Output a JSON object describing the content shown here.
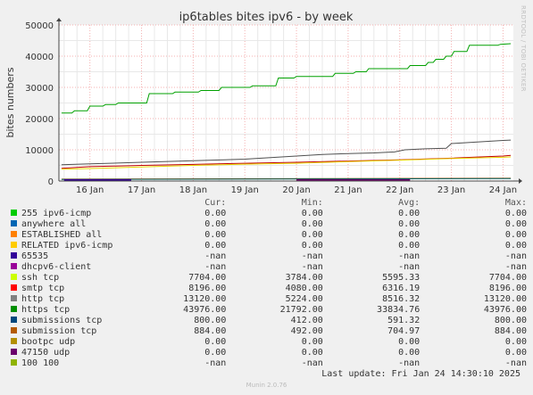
{
  "chart_data": {
    "type": "line",
    "title": "ip6tables bites ipv6 - by week",
    "ylabel": "bites numbers",
    "xlabel": "",
    "ylim": [
      0,
      50000
    ],
    "yticks": [
      0,
      10000,
      20000,
      30000,
      40000,
      50000
    ],
    "ytick_labels": [
      "0",
      "10000",
      "20000",
      "30000",
      "40000",
      "50000"
    ],
    "xlim": [
      15.4,
      24.2
    ],
    "xticks": [
      16,
      17,
      18,
      19,
      20,
      21,
      22,
      23,
      24
    ],
    "xtick_labels": [
      "16 Jan",
      "17 Jan",
      "18 Jan",
      "19 Jan",
      "20 Jan",
      "21 Jan",
      "22 Jan",
      "23 Jan",
      "24 Jan"
    ],
    "grid": true,
    "x_unit": "days of January 2025",
    "series": [
      {
        "name": "https tcp",
        "color": "#00a000",
        "x": [
          15.45,
          15.65,
          15.7,
          15.95,
          16.0,
          16.25,
          16.3,
          16.5,
          16.55,
          17.1,
          17.15,
          17.6,
          17.65,
          18.1,
          18.15,
          18.5,
          18.55,
          19.1,
          19.15,
          19.2,
          19.25,
          19.6,
          19.65,
          19.95,
          20.0,
          20.7,
          20.75,
          21.1,
          21.15,
          21.35,
          21.4,
          22.15,
          22.2,
          22.5,
          22.55,
          22.65,
          22.7,
          22.85,
          22.9,
          23.0,
          23.05,
          23.3,
          23.35,
          23.9,
          23.95,
          24.15
        ],
        "y": [
          21800,
          21800,
          22500,
          22500,
          24000,
          24000,
          24500,
          24500,
          25000,
          25000,
          28000,
          28000,
          28500,
          28500,
          29000,
          29000,
          30000,
          30000,
          30500,
          30500,
          30500,
          30500,
          33000,
          33000,
          33500,
          33500,
          34500,
          34500,
          35000,
          35000,
          36000,
          36000,
          37000,
          37000,
          38000,
          38000,
          39000,
          39000,
          40000,
          40000,
          41500,
          41500,
          43500,
          43500,
          43800,
          44000
        ]
      },
      {
        "name": "http tcp",
        "color": "#505050",
        "x": [
          15.45,
          16.0,
          17.0,
          18.0,
          19.0,
          19.5,
          20.0,
          20.5,
          21.0,
          21.5,
          21.9,
          22.1,
          22.5,
          22.9,
          23.0,
          23.5,
          24.0,
          24.15
        ],
        "y": [
          5200,
          5500,
          6000,
          6500,
          7000,
          7500,
          8000,
          8500,
          8800,
          9000,
          9300,
          10000,
          10300,
          10500,
          12000,
          12500,
          13000,
          13120
        ]
      },
      {
        "name": "smtp tcp",
        "color": "#c00000",
        "x": [
          15.45,
          16.0,
          16.5,
          17.0,
          18.0,
          19.0,
          20.0,
          21.0,
          22.0,
          23.0,
          23.5,
          24.0,
          24.15
        ],
        "y": [
          4080,
          4600,
          4800,
          5000,
          5300,
          5700,
          6000,
          6400,
          6800,
          7300,
          7700,
          8000,
          8196
        ]
      },
      {
        "name": "ssh tcp",
        "color": "#e8d800",
        "x": [
          15.45,
          16.0,
          17.0,
          18.0,
          19.0,
          20.0,
          21.0,
          22.0,
          23.0,
          24.0,
          24.15
        ],
        "y": [
          3784,
          4000,
          4500,
          5000,
          5400,
          5700,
          6200,
          6700,
          7200,
          7600,
          7704
        ]
      },
      {
        "name": "ESTABLISHED all",
        "color": "#ea8f00",
        "x": [
          15.45,
          24.15
        ],
        "y": [
          0,
          0
        ]
      },
      {
        "name": "submission tcp",
        "color": "#b05000",
        "x": [
          15.45,
          24.15
        ],
        "y": [
          600,
          884
        ]
      },
      {
        "name": "submissions tcp",
        "color": "#006060",
        "x": [
          15.45,
          24.15
        ],
        "y": [
          500,
          800
        ]
      }
    ],
    "legend": {
      "headers": [
        "Cur:",
        "Min:",
        "Avg:",
        "Max:"
      ],
      "rows": [
        {
          "name": "255 ipv6-icmp",
          "color": "#00cc00",
          "cur": "0.00",
          "min": "0.00",
          "avg": "0.00",
          "max": "0.00"
        },
        {
          "name": "anywhere all",
          "color": "#0066b3",
          "cur": "0.00",
          "min": "0.00",
          "avg": "0.00",
          "max": "0.00"
        },
        {
          "name": "ESTABLISHED all",
          "color": "#ff8000",
          "cur": "0.00",
          "min": "0.00",
          "avg": "0.00",
          "max": "0.00"
        },
        {
          "name": "RELATED ipv6-icmp",
          "color": "#ffcc00",
          "cur": "0.00",
          "min": "0.00",
          "avg": "0.00",
          "max": "0.00"
        },
        {
          "name": "65535",
          "color": "#330099",
          "cur": "-nan",
          "min": "-nan",
          "avg": "-nan",
          "max": "-nan"
        },
        {
          "name": "dhcpv6-client",
          "color": "#990099",
          "cur": "-nan",
          "min": "-nan",
          "avg": "-nan",
          "max": "-nan"
        },
        {
          "name": "ssh tcp",
          "color": "#ccff00",
          "cur": "7704.00",
          "min": "3784.00",
          "avg": "5595.33",
          "max": "7704.00"
        },
        {
          "name": "smtp tcp",
          "color": "#ff0000",
          "cur": "8196.00",
          "min": "4080.00",
          "avg": "6316.19",
          "max": "8196.00"
        },
        {
          "name": "http tcp",
          "color": "#808080",
          "cur": "13120.00",
          "min": "5224.00",
          "avg": "8516.32",
          "max": "13120.00"
        },
        {
          "name": "https tcp",
          "color": "#008f00",
          "cur": "43976.00",
          "min": "21792.00",
          "avg": "33834.76",
          "max": "43976.00"
        },
        {
          "name": "submissions tcp",
          "color": "#00487d",
          "cur": "800.00",
          "min": "412.00",
          "avg": "591.32",
          "max": "800.00"
        },
        {
          "name": "submission tcp",
          "color": "#b35a00",
          "cur": "884.00",
          "min": "492.00",
          "avg": "704.97",
          "max": "884.00"
        },
        {
          "name": "bootpc udp",
          "color": "#b38f00",
          "cur": "0.00",
          "min": "0.00",
          "avg": "0.00",
          "max": "0.00"
        },
        {
          "name": "47150 udp",
          "color": "#6b006b",
          "cur": "0.00",
          "min": "0.00",
          "avg": "0.00",
          "max": "0.00"
        },
        {
          "name": "100 100",
          "color": "#8fb300",
          "cur": "-nan",
          "min": "-nan",
          "avg": "-nan",
          "max": "-nan"
        }
      ]
    }
  },
  "last_update": "Last update: Fri Jan 24 14:30:10 2025",
  "footer": "Munin 2.0.76",
  "side_label": "RRDTOOL / TOBI OETIKER"
}
